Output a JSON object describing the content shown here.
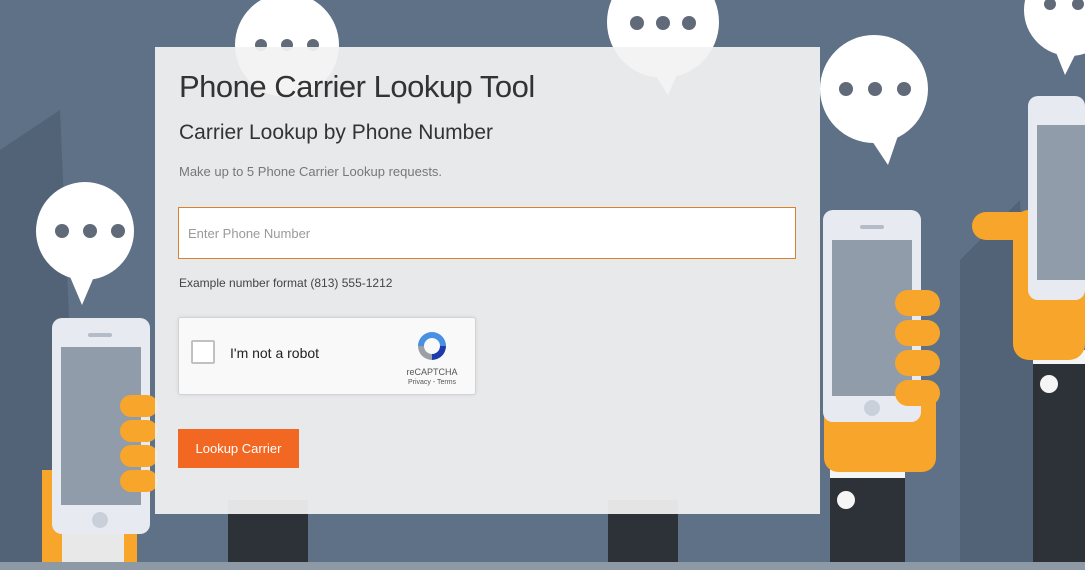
{
  "page": {
    "title": "Phone Carrier Lookup Tool",
    "subtitle": "Carrier Lookup by Phone Number",
    "intro": "Make up to 5 Phone Carrier Lookup requests."
  },
  "form": {
    "phone_placeholder": "Enter Phone Number",
    "phone_value": "",
    "example": "Example number format (813) 555-1212",
    "submit_label": "Lookup Carrier"
  },
  "captcha": {
    "label": "I'm not a robot",
    "brand": "reCAPTCHA",
    "links": "Privacy - Terms",
    "checked": false
  },
  "colors": {
    "background": "#5f7187",
    "accent": "#f26722",
    "input_border": "#d9822b",
    "hand": "#f7a52b"
  },
  "background_icons": [
    "chat-bubble-icon",
    "smartphone-icon",
    "hand-icon"
  ]
}
